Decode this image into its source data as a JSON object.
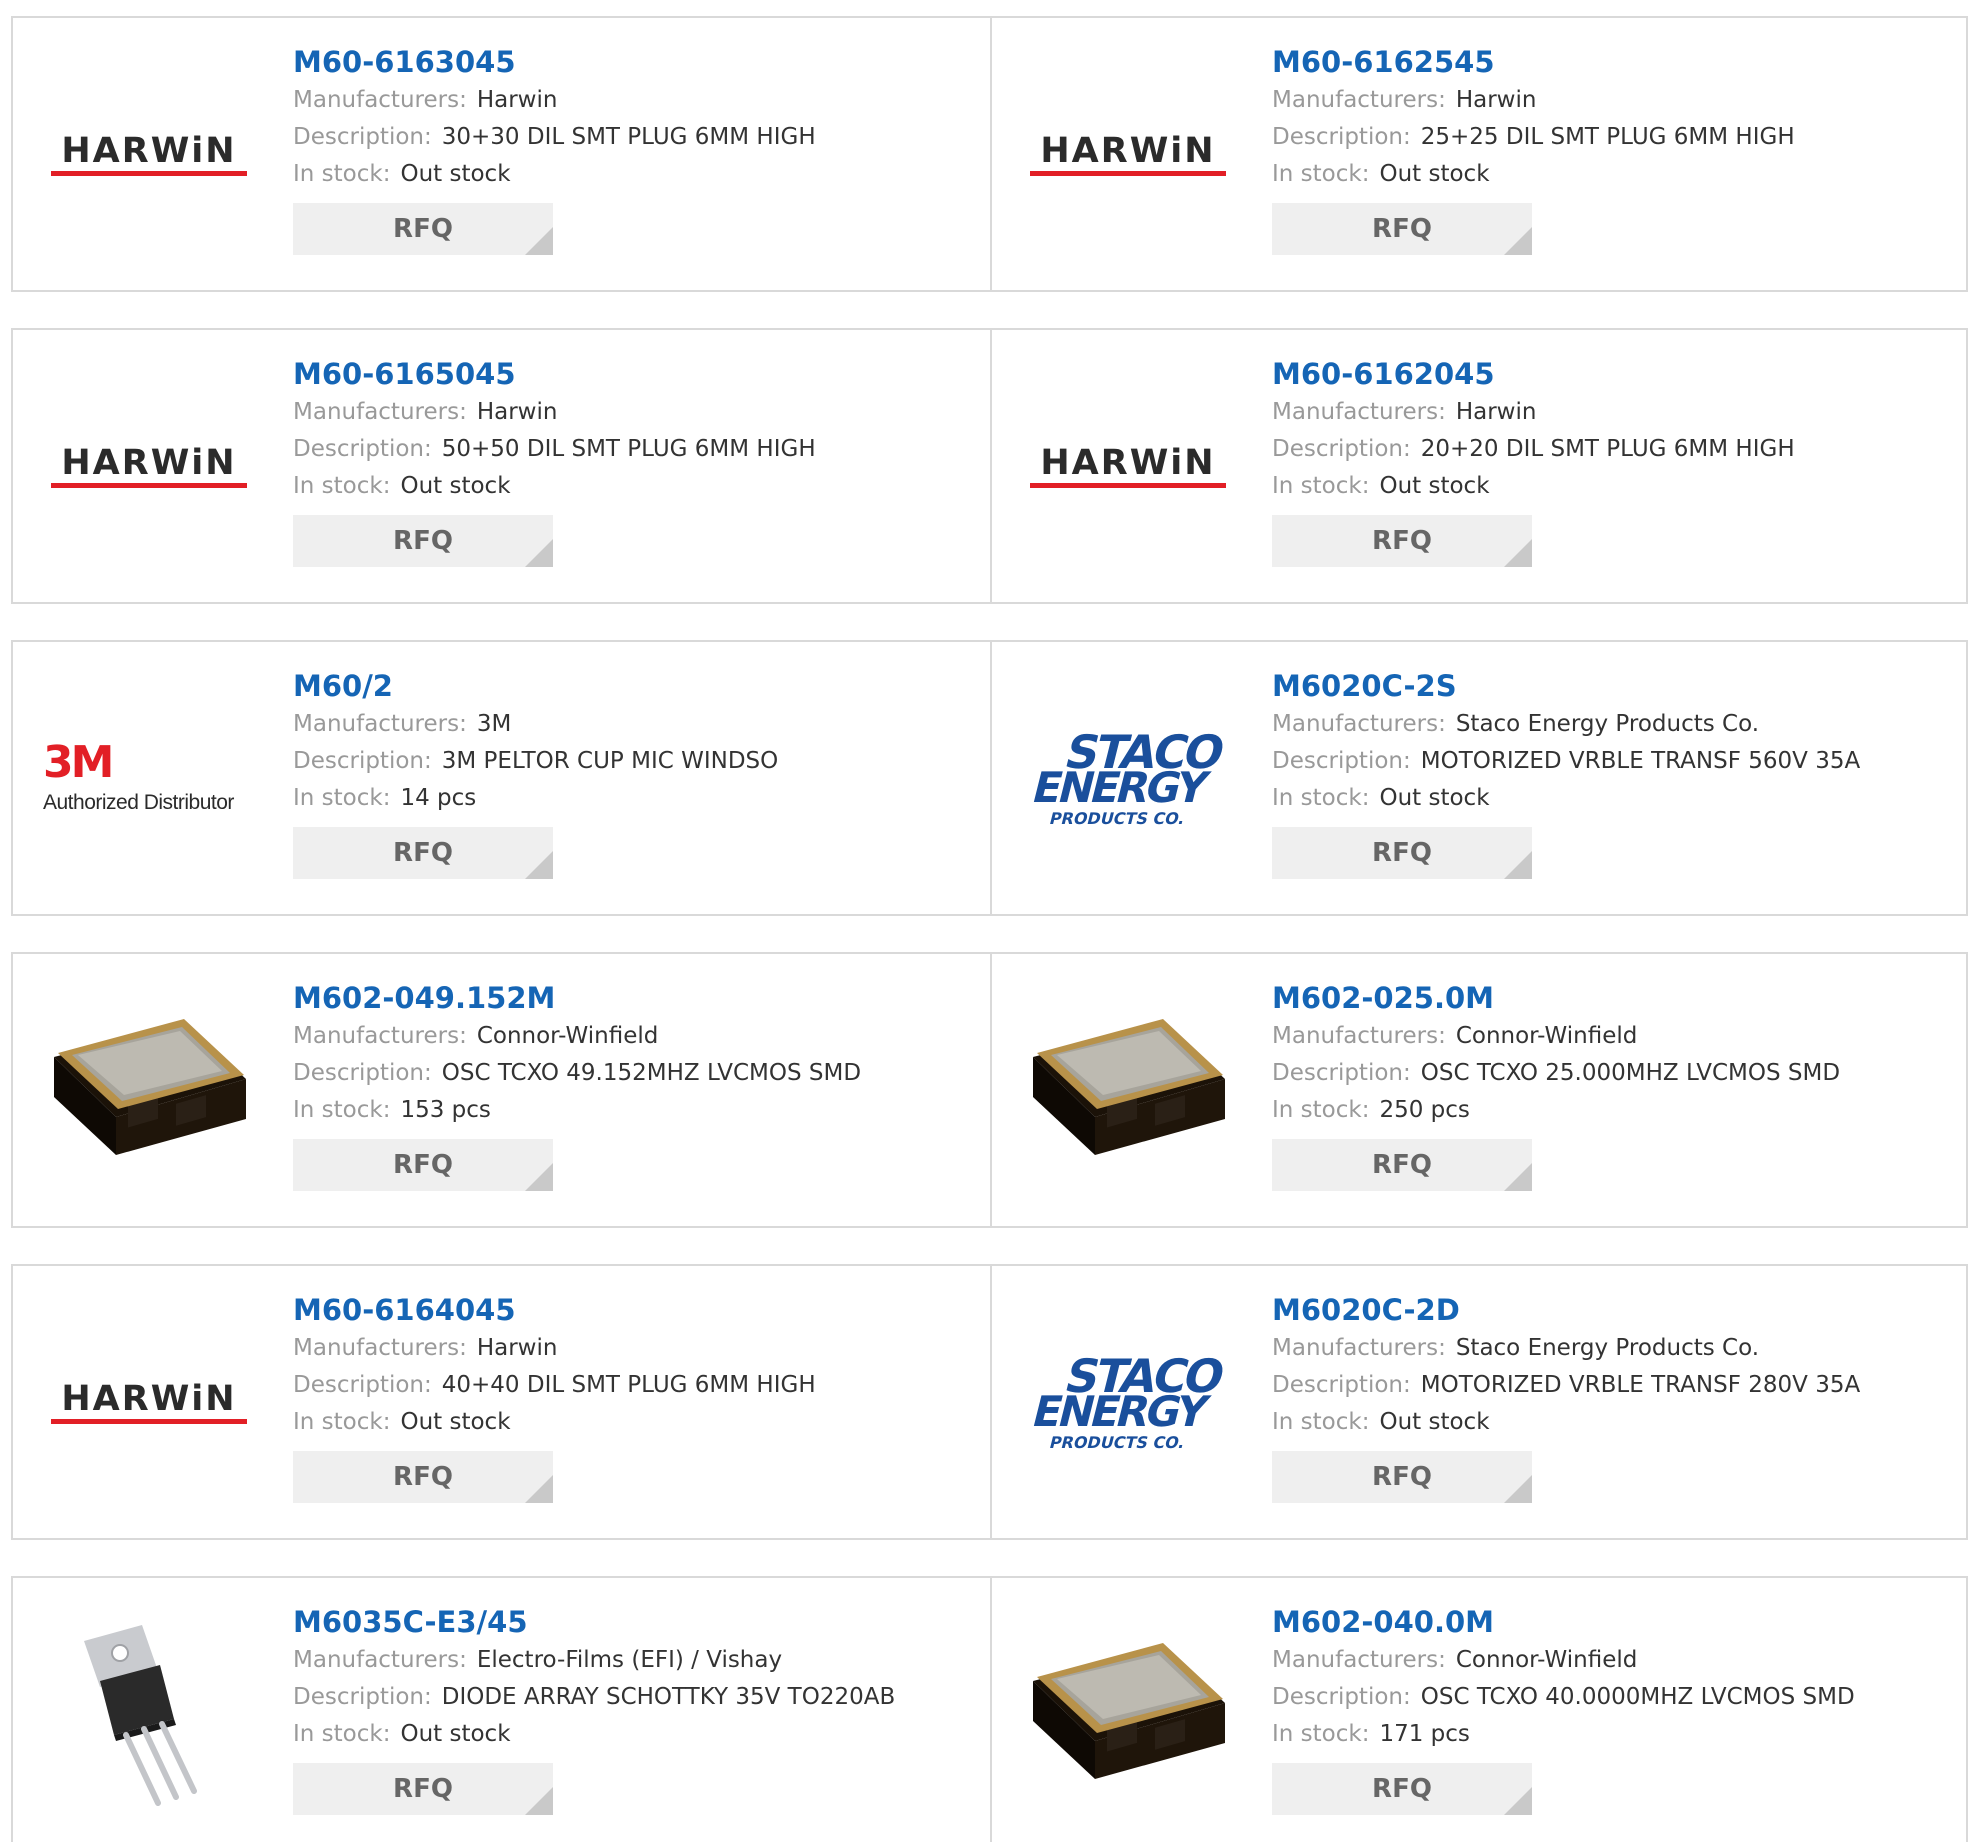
{
  "labels": {
    "manufacturers": "Manufacturers:",
    "description": "Description:",
    "in_stock": "In stock:",
    "rfq": "RFQ"
  },
  "colors": {
    "part_number": "#1565b5",
    "label": "#999999",
    "value": "#333333",
    "rfq_background": "#efefef",
    "border": "#d9d9d9"
  },
  "logos": {
    "harwin": "HARWiN",
    "three_m": "3M",
    "three_m_sub": "Authorized Distributor",
    "staco_line1": "STACO",
    "staco_line2": "ENERGY",
    "staco_line3": "PRODUCTS CO."
  },
  "products": [
    {
      "part_number": "M60-6163045",
      "manufacturer": "Harwin",
      "description": "30+30 DIL SMT PLUG 6MM HIGH",
      "stock": "Out stock",
      "image": "harwin-logo"
    },
    {
      "part_number": "M60-6162545",
      "manufacturer": "Harwin",
      "description": "25+25 DIL SMT PLUG 6MM HIGH",
      "stock": "Out stock",
      "image": "harwin-logo"
    },
    {
      "part_number": "M60-6165045",
      "manufacturer": "Harwin",
      "description": "50+50 DIL SMT PLUG 6MM HIGH",
      "stock": "Out stock",
      "image": "harwin-logo"
    },
    {
      "part_number": "M60-6162045",
      "manufacturer": "Harwin",
      "description": "20+20 DIL SMT PLUG 6MM HIGH",
      "stock": "Out stock",
      "image": "harwin-logo"
    },
    {
      "part_number": "M60/2",
      "manufacturer": "3M",
      "description": "3M PELTOR CUP MIC WINDSO",
      "stock": "14 pcs",
      "image": "3m-logo"
    },
    {
      "part_number": "M6020C-2S",
      "manufacturer": "Staco Energy Products Co.",
      "description": "MOTORIZED VRBLE TRANSF 560V 35A",
      "stock": "Out stock",
      "image": "staco-logo"
    },
    {
      "part_number": "M602-049.152M",
      "manufacturer": "Connor-Winfield",
      "description": "OSC TCXO 49.152MHZ LVCMOS SMD",
      "stock": "153 pcs",
      "image": "oscillator-photo"
    },
    {
      "part_number": "M602-025.0M",
      "manufacturer": "Connor-Winfield",
      "description": "OSC TCXO 25.000MHZ LVCMOS SMD",
      "stock": "250 pcs",
      "image": "oscillator-photo"
    },
    {
      "part_number": "M60-6164045",
      "manufacturer": "Harwin",
      "description": "40+40 DIL SMT PLUG 6MM HIGH",
      "stock": "Out stock",
      "image": "harwin-logo"
    },
    {
      "part_number": "M6020C-2D",
      "manufacturer": "Staco Energy Products Co.",
      "description": "MOTORIZED VRBLE TRANSF 280V 35A",
      "stock": "Out stock",
      "image": "staco-logo"
    },
    {
      "part_number": "M6035C-E3/45",
      "manufacturer": "Electro-Films (EFI) / Vishay",
      "description": "DIODE ARRAY SCHOTTKY 35V TO220AB",
      "stock": "Out stock",
      "image": "to220-photo"
    },
    {
      "part_number": "M602-040.0M",
      "manufacturer": "Connor-Winfield",
      "description": "OSC TCXO 40.0000MHZ LVCMOS SMD",
      "stock": "171 pcs",
      "image": "oscillator-photo"
    }
  ]
}
